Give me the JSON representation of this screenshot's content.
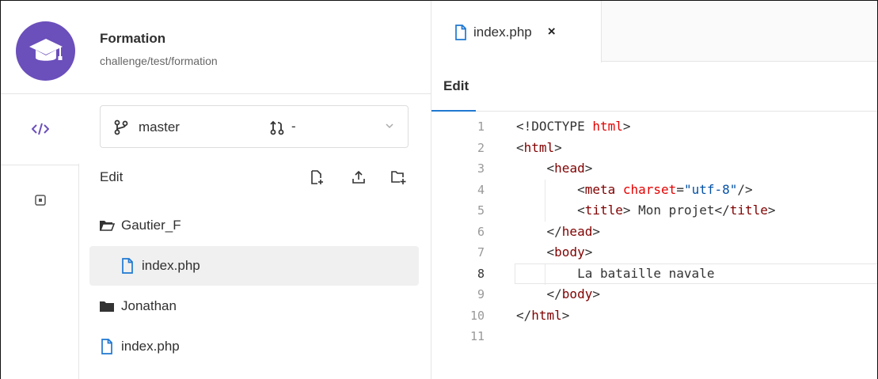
{
  "project": {
    "name": "Formation",
    "path": "challenge/test/formation"
  },
  "rail": {
    "items": [
      {
        "icon": "code-icon",
        "label": "</>"
      },
      {
        "icon": "pipeline-icon",
        "label": ""
      }
    ]
  },
  "branch": {
    "name": "master",
    "merge_request": "-"
  },
  "tree": {
    "edit_label": "Edit",
    "actions": [
      "new-file-icon",
      "upload-icon",
      "new-folder-icon"
    ],
    "items": [
      {
        "type": "folder-open",
        "label": "Gautier_F"
      },
      {
        "type": "file",
        "label": "index.php"
      },
      {
        "type": "folder",
        "label": "Jonathan"
      },
      {
        "type": "file",
        "label": "index.php"
      }
    ]
  },
  "editor": {
    "tab_label": "index.php",
    "tab_close": "×",
    "mode": "Edit",
    "current_line": 8,
    "lines": [
      {
        "n": "1",
        "text": "<!DOCTYPE html>"
      },
      {
        "n": "2",
        "text": "<html>"
      },
      {
        "n": "3",
        "text": "    <head>"
      },
      {
        "n": "4",
        "text": "        <meta charset=\"utf-8\"/>"
      },
      {
        "n": "5",
        "text": "        <title> Mon projet</title>"
      },
      {
        "n": "6",
        "text": "    </head>"
      },
      {
        "n": "7",
        "text": "    <body>"
      },
      {
        "n": "8",
        "text": "        La bataille navale"
      },
      {
        "n": "9",
        "text": "    </body>"
      },
      {
        "n": "10",
        "text": "</html>"
      },
      {
        "n": "11",
        "text": ""
      }
    ]
  },
  "colors": {
    "avatar": "#6b4fbb",
    "accent": "#1f78d1",
    "tag": "#800000",
    "attr": "#e50000",
    "string": "#0451a5"
  }
}
